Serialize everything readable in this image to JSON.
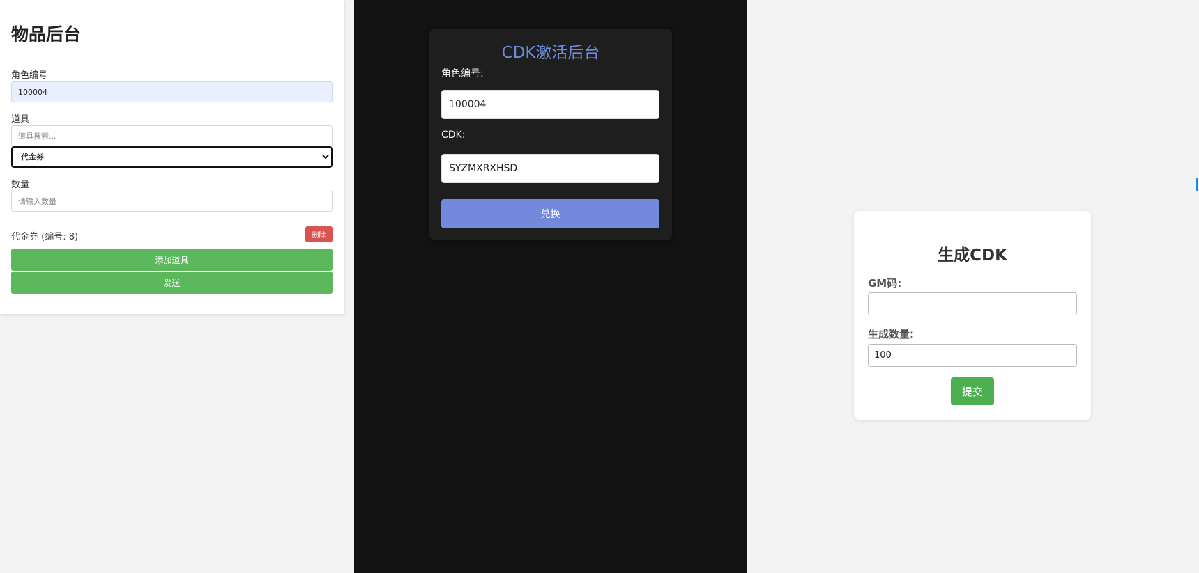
{
  "item_panel": {
    "title": "物品后台",
    "role_label": "角色编号",
    "role_value": "100004",
    "item_label": "道具",
    "item_search_placeholder": "道具搜索...",
    "item_selected": "代金券",
    "quantity_label": "数量",
    "quantity_placeholder": "请输入数量",
    "added_item_text": "代金券 (编号: 8)",
    "delete_label": "删除",
    "add_item_label": "添加道具",
    "send_label": "发送"
  },
  "cdk_panel": {
    "title": "CDK激活后台",
    "role_label": "角色编号:",
    "role_value": "100004",
    "cdk_label": "CDK:",
    "cdk_value": "SYZMXRXHSD",
    "redeem_label": "兑换"
  },
  "generate_panel": {
    "title": "生成CDK",
    "gm_label": "GM码:",
    "gm_value": "",
    "count_label": "生成数量:",
    "count_value": "100",
    "submit_label": "提交"
  },
  "colors": {
    "green": "#5cb85c",
    "delete_red": "#d9534f",
    "cdk_accent": "#6f8bdc",
    "dark_bg": "#131313",
    "submit_green": "#4caf50"
  }
}
